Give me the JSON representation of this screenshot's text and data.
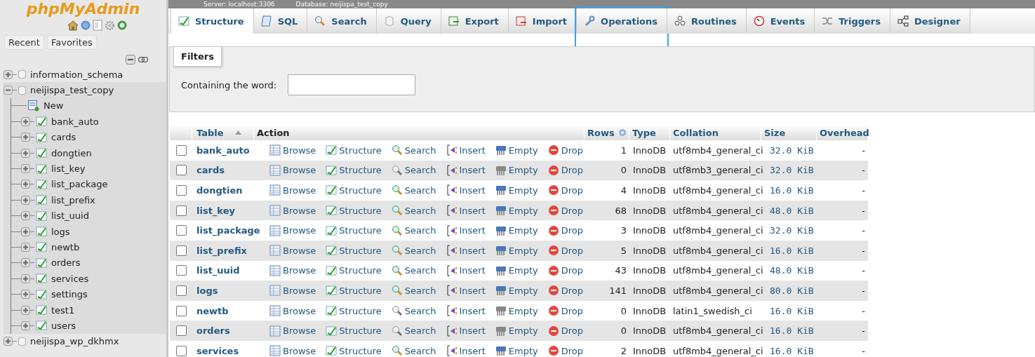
{
  "sidebar": {
    "logo": "phpMyAdmin",
    "buttons": [
      {
        "label": "Recent"
      },
      {
        "label": "Favorites"
      }
    ],
    "tree": [
      {
        "kind": "database",
        "name": "information_schema",
        "expanded": false,
        "selected": false
      },
      {
        "kind": "database",
        "name": "neijispa_test_copy",
        "expanded": true,
        "selected": true,
        "children": [
          {
            "kind": "new",
            "name": "New"
          },
          {
            "kind": "table",
            "name": "bank_auto",
            "expanded": false
          },
          {
            "kind": "table",
            "name": "cards",
            "expanded": false
          },
          {
            "kind": "table",
            "name": "dongtien",
            "expanded": false
          },
          {
            "kind": "table",
            "name": "list_key",
            "expanded": false
          },
          {
            "kind": "table",
            "name": "list_package",
            "expanded": false
          },
          {
            "kind": "table",
            "name": "list_prefix",
            "expanded": false
          },
          {
            "kind": "table",
            "name": "list_uuid",
            "expanded": false
          },
          {
            "kind": "table",
            "name": "logs",
            "expanded": false
          },
          {
            "kind": "table",
            "name": "newtb",
            "expanded": false
          },
          {
            "kind": "table",
            "name": "orders",
            "expanded": false
          },
          {
            "kind": "table",
            "name": "services",
            "expanded": false
          },
          {
            "kind": "table",
            "name": "settings",
            "expanded": false
          },
          {
            "kind": "table",
            "name": "test1",
            "expanded": false
          },
          {
            "kind": "table",
            "name": "users",
            "expanded": false
          }
        ]
      },
      {
        "kind": "database",
        "name": "neijispa_wp_dkhmx",
        "expanded": false,
        "selected": false
      }
    ]
  },
  "breadcrumb": [
    "Server: localhost:3306",
    "Database: neijispa_test_copy"
  ],
  "tabs": [
    {
      "kind": "structure",
      "label": "Structure",
      "selected": true,
      "highlighted": false
    },
    {
      "kind": "sql",
      "label": "SQL",
      "selected": false,
      "highlighted": false
    },
    {
      "kind": "search",
      "label": "Search",
      "selected": false,
      "highlighted": false
    },
    {
      "kind": "query",
      "label": "Query",
      "selected": false,
      "highlighted": false
    },
    {
      "kind": "export",
      "label": "Export",
      "selected": false,
      "highlighted": false
    },
    {
      "kind": "import",
      "label": "Import",
      "selected": false,
      "highlighted": false
    },
    {
      "kind": "operations",
      "label": "Operations",
      "selected": false,
      "highlighted": true
    },
    {
      "kind": "routines",
      "label": "Routines",
      "selected": false,
      "highlighted": false
    },
    {
      "kind": "events",
      "label": "Events",
      "selected": false,
      "highlighted": false
    },
    {
      "kind": "triggers",
      "label": "Triggers",
      "selected": false,
      "highlighted": false
    },
    {
      "kind": "designer",
      "label": "Designer",
      "selected": false,
      "highlighted": false
    }
  ],
  "filters": {
    "legend": "Filters",
    "label": "Containing the word:"
  },
  "table": {
    "columns": [
      "Table",
      "Action",
      "Rows",
      "Type",
      "Collation",
      "Size",
      "Overhead"
    ],
    "rows": [
      {
        "name": "bank_auto",
        "checked": false,
        "has_data": true,
        "actions": [
          "Browse",
          "Structure",
          "Search",
          "Insert",
          "Empty",
          "Drop"
        ],
        "rows": "1",
        "type": "InnoDB",
        "collation": "utf8mb4_general_ci",
        "size": "32.0 KiB",
        "overhead": "-"
      },
      {
        "name": "cards",
        "checked": false,
        "has_data": false,
        "actions": [
          "Browse",
          "Structure",
          "Search",
          "Insert",
          "Empty",
          "Drop"
        ],
        "rows": "0",
        "type": "InnoDB",
        "collation": "utf8mb3_general_ci",
        "size": "32.0 KiB",
        "overhead": "-"
      },
      {
        "name": "dongtien",
        "checked": false,
        "has_data": true,
        "actions": [
          "Browse",
          "Structure",
          "Search",
          "Insert",
          "Empty",
          "Drop"
        ],
        "rows": "4",
        "type": "InnoDB",
        "collation": "utf8mb4_general_ci",
        "size": "16.0 KiB",
        "overhead": "-"
      },
      {
        "name": "list_key",
        "checked": false,
        "has_data": true,
        "actions": [
          "Browse",
          "Structure",
          "Search",
          "Insert",
          "Empty",
          "Drop"
        ],
        "rows": "68",
        "type": "InnoDB",
        "collation": "utf8mb4_general_ci",
        "size": "48.0 KiB",
        "overhead": "-"
      },
      {
        "name": "list_package",
        "checked": false,
        "has_data": true,
        "actions": [
          "Browse",
          "Structure",
          "Search",
          "Insert",
          "Empty",
          "Drop"
        ],
        "rows": "3",
        "type": "InnoDB",
        "collation": "utf8mb4_general_ci",
        "size": "32.0 KiB",
        "overhead": "-"
      },
      {
        "name": "list_prefix",
        "checked": false,
        "has_data": true,
        "actions": [
          "Browse",
          "Structure",
          "Search",
          "Insert",
          "Empty",
          "Drop"
        ],
        "rows": "5",
        "type": "InnoDB",
        "collation": "utf8mb4_general_ci",
        "size": "16.0 KiB",
        "overhead": "-"
      },
      {
        "name": "list_uuid",
        "checked": false,
        "has_data": true,
        "actions": [
          "Browse",
          "Structure",
          "Search",
          "Insert",
          "Empty",
          "Drop"
        ],
        "rows": "43",
        "type": "InnoDB",
        "collation": "utf8mb4_general_ci",
        "size": "48.0 KiB",
        "overhead": "-"
      },
      {
        "name": "logs",
        "checked": false,
        "has_data": true,
        "actions": [
          "Browse",
          "Structure",
          "Search",
          "Insert",
          "Empty",
          "Drop"
        ],
        "rows": "141",
        "type": "InnoDB",
        "collation": "utf8mb4_general_ci",
        "size": "80.0 KiB",
        "overhead": "-"
      },
      {
        "name": "newtb",
        "checked": false,
        "has_data": false,
        "actions": [
          "Browse",
          "Structure",
          "Search",
          "Insert",
          "Empty",
          "Drop"
        ],
        "rows": "0",
        "type": "InnoDB",
        "collation": "latin1_swedish_ci",
        "size": "16.0 KiB",
        "overhead": "-"
      },
      {
        "name": "orders",
        "checked": false,
        "has_data": false,
        "actions": [
          "Browse",
          "Structure",
          "Search",
          "Insert",
          "Empty",
          "Drop"
        ],
        "rows": "0",
        "type": "InnoDB",
        "collation": "utf8mb4_general_ci",
        "size": "16.0 KiB",
        "overhead": "-"
      },
      {
        "name": "services",
        "checked": false,
        "has_data": true,
        "actions": [
          "Browse",
          "Structure",
          "Search",
          "Insert",
          "Empty",
          "Drop"
        ],
        "rows": "2",
        "type": "InnoDB",
        "collation": "utf8mb4_general_ci",
        "size": "16.0 KiB",
        "overhead": "-"
      }
    ]
  }
}
